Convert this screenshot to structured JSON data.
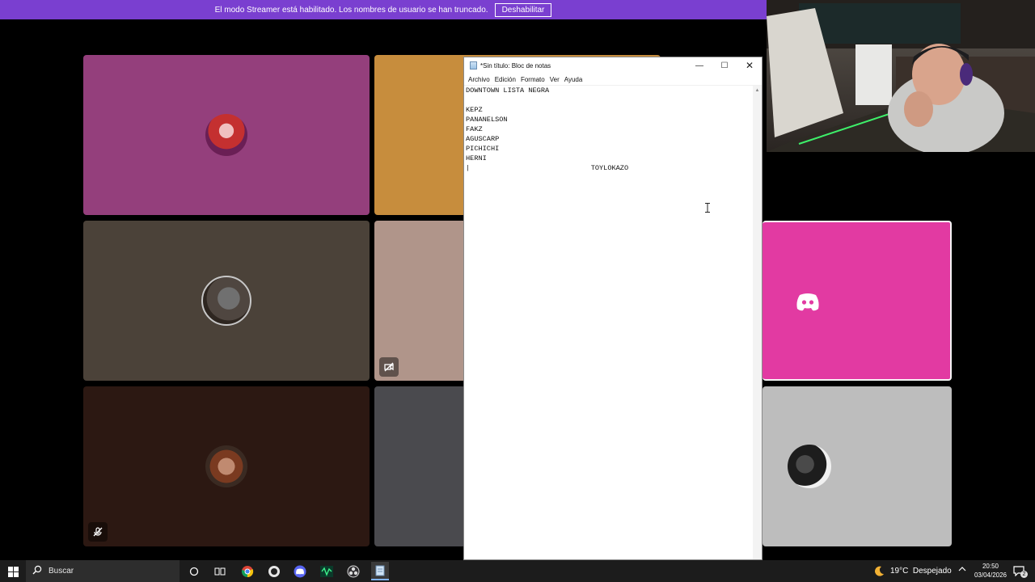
{
  "banner": {
    "message": "El modo Streamer está habilitado. Los nombres de usuario se han truncado.",
    "button_label": "Deshabilitar"
  },
  "tiles": {
    "colors": [
      "#943f7c",
      "#c78d3d",
      "#4b4239",
      "#b0958a",
      "#e23aa2",
      "#2c1812",
      "#4a4a4e",
      "#bdbdbd"
    ]
  },
  "notepad": {
    "title": "*Sin título: Bloc de notas",
    "menu": [
      "Archivo",
      "Edición",
      "Formato",
      "Ver",
      "Ayuda"
    ],
    "content": "DOWNTOWN LISTA NEGRA\n\nKEPZ\nPANANELSON\nFAKZ\nAGUSCARP\nPICHICHI\nHERNI\n|                             TOYLOKAZO"
  },
  "taskbar": {
    "search_placeholder": "Buscar",
    "weather": "19°C  Despejado",
    "time": "20:50",
    "date": "03/04/2026",
    "notification_count": "2"
  },
  "icons": {
    "start": "windows-logo-icon",
    "search": "search-icon",
    "cortana": "cortana-icon",
    "task_view": "task-view-icon",
    "discord": "discord-icon"
  }
}
